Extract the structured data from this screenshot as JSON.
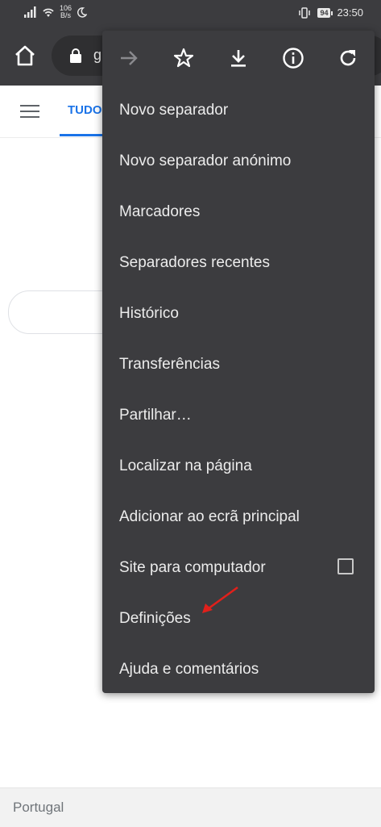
{
  "status_bar": {
    "net_speed_value": "106",
    "net_speed_unit": "B/s",
    "battery": "94",
    "time": "23:50"
  },
  "toolbar": {
    "url_partial": "g"
  },
  "page": {
    "tab_all": "TUDO",
    "footer_country": "Portugal"
  },
  "menu": {
    "top_icons": [
      "forward-icon",
      "star-icon",
      "download-icon",
      "info-icon",
      "refresh-icon"
    ],
    "items": [
      {
        "label": "Novo separador"
      },
      {
        "label": "Novo separador anónimo"
      },
      {
        "label": "Marcadores"
      },
      {
        "label": "Separadores recentes"
      },
      {
        "label": "Histórico"
      },
      {
        "label": "Transferências"
      },
      {
        "label": "Partilhar…"
      },
      {
        "label": "Localizar na página"
      },
      {
        "label": "Adicionar ao ecrã principal"
      },
      {
        "label": "Site para computador",
        "checked": false
      },
      {
        "label": "Definições"
      },
      {
        "label": "Ajuda e comentários"
      }
    ]
  },
  "colors": {
    "chrome_dark": "#3c3c3f",
    "menu_text": "#ececec",
    "accent_blue": "#1a73e8",
    "annotation_red": "#e0201b"
  }
}
